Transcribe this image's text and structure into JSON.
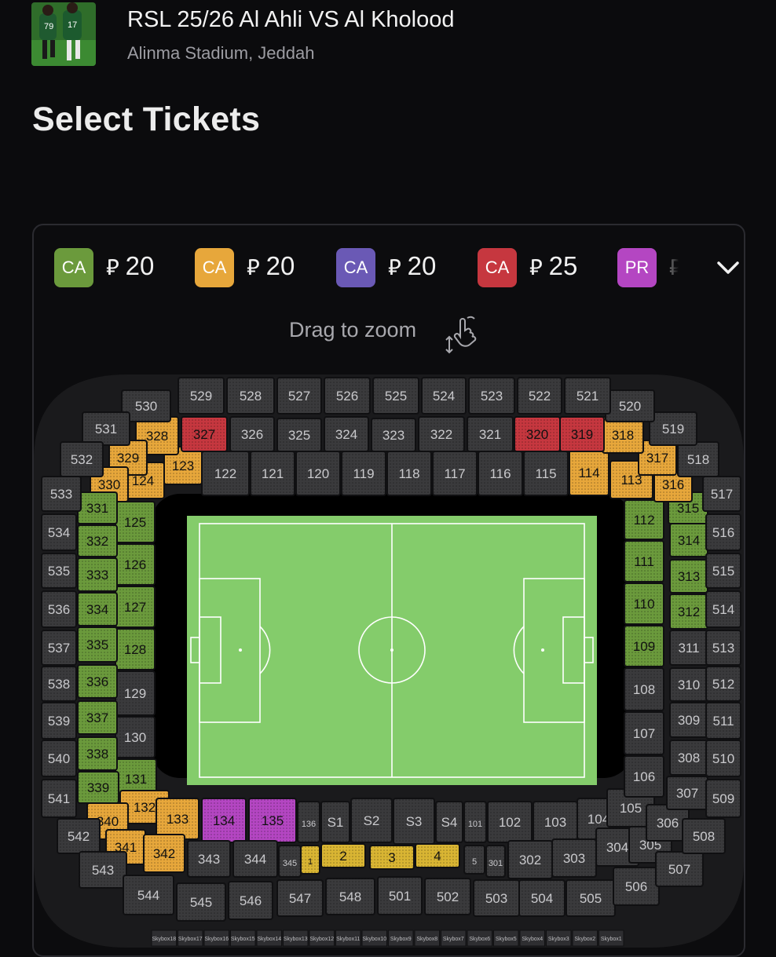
{
  "event": {
    "title": "RSL 25/26 Al Ahli VS Al Kholood",
    "venue": "Alinma Stadium, Jeddah"
  },
  "page_title": "Select Tickets",
  "currency_symbol": "⃁",
  "legend": [
    {
      "code": "CA",
      "price": "20",
      "color": "#6b9a3c"
    },
    {
      "code": "CA",
      "price": "20",
      "color": "#e7a73b"
    },
    {
      "code": "CA",
      "price": "20",
      "color": "#6a59b5"
    },
    {
      "code": "CA",
      "price": "25",
      "color": "#c6373f"
    },
    {
      "code": "PR",
      "price": "",
      "color": "#b446c2"
    }
  ],
  "zoom_hint": "Drag to zoom",
  "colors": {
    "green": "#6b9a3c",
    "orange": "#e7a73b",
    "red": "#c6373f",
    "magenta": "#b446c2",
    "yellow": "#d9b533",
    "grey": "#3a3a3c",
    "pitch": "#84cc6b"
  },
  "sections": {
    "green": [
      "331",
      "332",
      "333",
      "334",
      "335",
      "336",
      "337",
      "338",
      "339",
      "125",
      "126",
      "127",
      "128",
      "131",
      "112",
      "111",
      "110",
      "109",
      "315",
      "314",
      "313",
      "312"
    ],
    "orange": [
      "328",
      "329",
      "330",
      "123",
      "124",
      "132",
      "133",
      "340",
      "341",
      "342",
      "318",
      "317",
      "316",
      "114",
      "113"
    ],
    "red": [
      "327",
      "320",
      "319"
    ],
    "magenta": [
      "134",
      "135"
    ],
    "yellow": [
      "1",
      "2",
      "3",
      "4"
    ],
    "grey": [
      "529",
      "528",
      "527",
      "526",
      "525",
      "524",
      "523",
      "522",
      "521",
      "530",
      "520",
      "531",
      "519",
      "532",
      "518",
      "533",
      "517",
      "534",
      "516",
      "535",
      "515",
      "536",
      "514",
      "537",
      "513",
      "538",
      "512",
      "539",
      "511",
      "540",
      "510",
      "541",
      "509",
      "542",
      "508",
      "543",
      "507",
      "544",
      "545",
      "546",
      "547",
      "548",
      "501",
      "502",
      "503",
      "504",
      "505",
      "506",
      "326",
      "325",
      "324",
      "323",
      "322",
      "321",
      "122",
      "121",
      "120",
      "119",
      "118",
      "117",
      "116",
      "115",
      "129",
      "130",
      "108",
      "107",
      "106",
      "105",
      "104",
      "103",
      "102",
      "101",
      "136",
      "S1",
      "S2",
      "S3",
      "S4",
      "5",
      "301",
      "302",
      "303",
      "304",
      "305",
      "306",
      "307",
      "308",
      "309",
      "310",
      "311",
      "343",
      "344",
      "345"
    ],
    "skyboxes": [
      "Skybox18",
      "Skybox17",
      "Skybox16",
      "Skybox15",
      "Skybox14",
      "Skybox13",
      "Skybox12",
      "Skybox11",
      "Skybox10",
      "Skybox9",
      "Skybox8",
      "Skybox7",
      "Skybox6",
      "Skybox5",
      "Skybox4",
      "Skybox3",
      "Skybox2",
      "Skybox1"
    ]
  }
}
